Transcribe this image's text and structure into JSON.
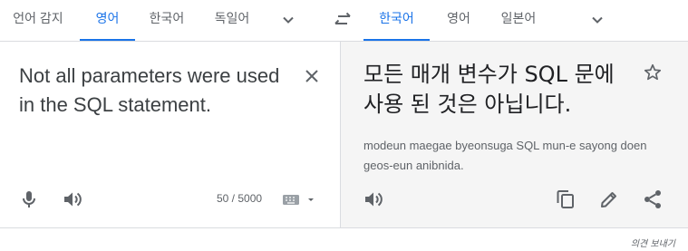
{
  "source_langs": {
    "items": [
      {
        "label": "언어 감지"
      },
      {
        "label": "영어"
      },
      {
        "label": "한국어"
      },
      {
        "label": "독일어"
      }
    ],
    "active_index": 1
  },
  "target_langs": {
    "items": [
      {
        "label": "한국어"
      },
      {
        "label": "영어"
      },
      {
        "label": "일본어"
      }
    ],
    "active_index": 0
  },
  "source": {
    "text": "Not all parameters were used in the SQL statement.",
    "char_count": "50 / 5000"
  },
  "target": {
    "text": "모든 매개 변수가 SQL 문에 사용 된 것은 아닙니다.",
    "romanization": "modeun maegae byeonsuga SQL mun-e sayong doen geos-eun anibnida."
  },
  "footer": {
    "feedback_label": "의견 보내기"
  },
  "icons": {
    "more_source": "chevron-down-icon",
    "more_target": "chevron-down-icon",
    "swap": "swap-icon",
    "clear": "close-icon",
    "mic": "mic-icon",
    "listen": "speaker-icon",
    "keyboard": "keyboard-icon",
    "star": "star-icon",
    "copy": "copy-icon",
    "edit": "pencil-icon",
    "share": "share-icon"
  },
  "colors": {
    "accent": "#1a73e8",
    "icon": "#5f6368",
    "output_bg": "#f5f5f5"
  }
}
